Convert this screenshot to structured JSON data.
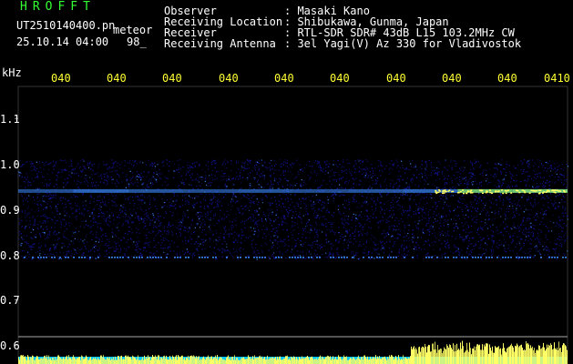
{
  "header": {
    "logo": "HROFFT",
    "filename": "UT2510140400.pn",
    "tag": "meteor",
    "datetime": "25.10.14 04:00",
    "count": "98_",
    "rows": [
      {
        "label": "Observer",
        "value": ": Masaki Kano"
      },
      {
        "label": "Receiving Location",
        "value": ": Shibukawa, Gunma, Japan"
      },
      {
        "label": "Receiver",
        "value": ": RTL-SDR SDR# 43dB L15 103.2MHz CW"
      },
      {
        "label": "Receiving Antenna",
        "value": ": 3el Yagi(V) Az 330 for Vladivostok"
      }
    ]
  },
  "colors": {
    "background": "#000000",
    "label_text": "#ffffff",
    "logo_text": "#33ff33",
    "time_ticks": "#ffff33",
    "signal_low": "#1414a0",
    "signal_mid": "#3c8cff",
    "signal_high": "#ffff66",
    "histogram_band": "#00c8ff"
  },
  "chart_data": {
    "type": "heatmap",
    "ylabel": "kHz",
    "ylim": [
      0.6,
      1.1
    ],
    "y_ticks": [
      "1.1",
      "1.0",
      "0.9",
      "0.8",
      "0.7",
      "0.6"
    ],
    "x_ticks": [
      "040",
      "040",
      "040",
      "040",
      "040",
      "040",
      "040",
      "040",
      "040",
      "0410"
    ],
    "noise_band_khz": [
      0.79,
      1.01
    ],
    "carrier_khz": 0.94,
    "carrier_intensity": [
      0.55,
      0.7,
      0.6,
      0.55,
      0.6,
      0.55,
      0.6,
      0.7,
      0.85,
      0.9
    ],
    "secondary_line_khz": 0.795
  }
}
